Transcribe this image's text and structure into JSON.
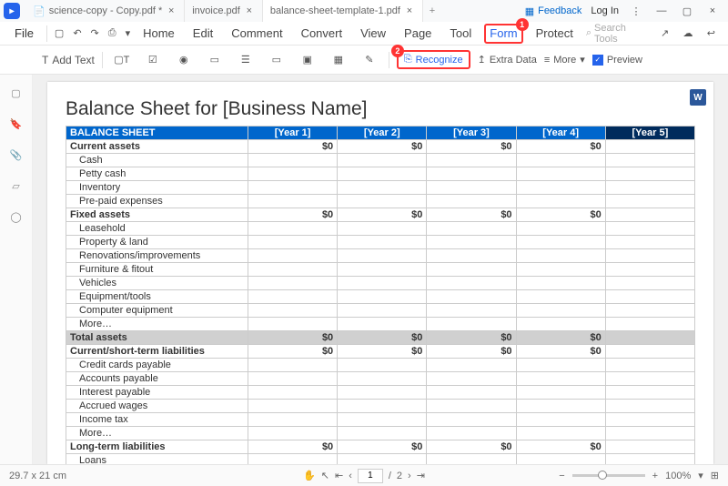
{
  "titlebar": {
    "tabs": [
      {
        "label": "science-copy - Copy.pdf *"
      },
      {
        "label": "invoice.pdf"
      },
      {
        "label": "balance-sheet-template-1.pdf"
      }
    ],
    "feedback": "Feedback",
    "login": "Log In"
  },
  "menubar": {
    "file": "File",
    "tabs": [
      "Home",
      "Edit",
      "Comment",
      "Convert",
      "View",
      "Page",
      "Tool",
      "Form",
      "Protect"
    ],
    "active_index": 7,
    "search_placeholder": "Search Tools"
  },
  "toolbar": {
    "add_text": "Add Text",
    "recognize": "Recognize",
    "extra_data": "Extra Data",
    "more": "More",
    "preview": "Preview"
  },
  "callouts": {
    "c1": "1",
    "c2": "2"
  },
  "document": {
    "title": "Balance Sheet for [Business Name]",
    "header_label": "BALANCE SHEET",
    "years": [
      "[Year 1]",
      "[Year 2]",
      "[Year 3]",
      "[Year 4]",
      "[Year 5]"
    ],
    "sections": [
      {
        "label": "Current assets",
        "bold": true,
        "vals": [
          "$0",
          "$0",
          "$0",
          "$0",
          ""
        ]
      },
      {
        "label": "Cash",
        "indent": true,
        "vals": [
          "",
          "",
          "",
          "",
          ""
        ]
      },
      {
        "label": "Petty cash",
        "indent": true,
        "vals": [
          "",
          "",
          "",
          "",
          ""
        ]
      },
      {
        "label": "Inventory",
        "indent": true,
        "vals": [
          "",
          "",
          "",
          "",
          ""
        ]
      },
      {
        "label": "Pre-paid expenses",
        "indent": true,
        "vals": [
          "",
          "",
          "",
          "",
          ""
        ]
      },
      {
        "label": "Fixed assets",
        "bold": true,
        "vals": [
          "$0",
          "$0",
          "$0",
          "$0",
          ""
        ]
      },
      {
        "label": "Leasehold",
        "indent": true,
        "vals": [
          "",
          "",
          "",
          "",
          ""
        ]
      },
      {
        "label": "Property & land",
        "indent": true,
        "vals": [
          "",
          "",
          "",
          "",
          ""
        ]
      },
      {
        "label": "Renovations/improvements",
        "indent": true,
        "vals": [
          "",
          "",
          "",
          "",
          ""
        ]
      },
      {
        "label": "Furniture & fitout",
        "indent": true,
        "vals": [
          "",
          "",
          "",
          "",
          ""
        ]
      },
      {
        "label": "Vehicles",
        "indent": true,
        "vals": [
          "",
          "",
          "",
          "",
          ""
        ]
      },
      {
        "label": "Equipment/tools",
        "indent": true,
        "vals": [
          "",
          "",
          "",
          "",
          ""
        ]
      },
      {
        "label": "Computer equipment",
        "indent": true,
        "vals": [
          "",
          "",
          "",
          "",
          ""
        ]
      },
      {
        "label": "More…",
        "indent": true,
        "vals": [
          "",
          "",
          "",
          "",
          ""
        ]
      },
      {
        "label": "Total assets",
        "grey": true,
        "vals": [
          "$0",
          "$0",
          "$0",
          "$0",
          ""
        ]
      },
      {
        "label": "Current/short-term liabilities",
        "bold": true,
        "vals": [
          "$0",
          "$0",
          "$0",
          "$0",
          ""
        ]
      },
      {
        "label": "Credit cards payable",
        "indent": true,
        "vals": [
          "",
          "",
          "",
          "",
          ""
        ]
      },
      {
        "label": "Accounts payable",
        "indent": true,
        "vals": [
          "",
          "",
          "",
          "",
          ""
        ]
      },
      {
        "label": "Interest payable",
        "indent": true,
        "vals": [
          "",
          "",
          "",
          "",
          ""
        ]
      },
      {
        "label": "Accrued wages",
        "indent": true,
        "vals": [
          "",
          "",
          "",
          "",
          ""
        ]
      },
      {
        "label": "Income tax",
        "indent": true,
        "vals": [
          "",
          "",
          "",
          "",
          ""
        ]
      },
      {
        "label": "More…",
        "indent": true,
        "vals": [
          "",
          "",
          "",
          "",
          ""
        ]
      },
      {
        "label": "Long-term liabilities",
        "bold": true,
        "vals": [
          "$0",
          "$0",
          "$0",
          "$0",
          ""
        ]
      },
      {
        "label": "Loans",
        "indent": true,
        "vals": [
          "",
          "",
          "",
          "",
          ""
        ]
      }
    ]
  },
  "statusbar": {
    "dimensions": "29.7 x 21 cm",
    "page_current": "1",
    "page_total": "2",
    "zoom": "100%"
  }
}
